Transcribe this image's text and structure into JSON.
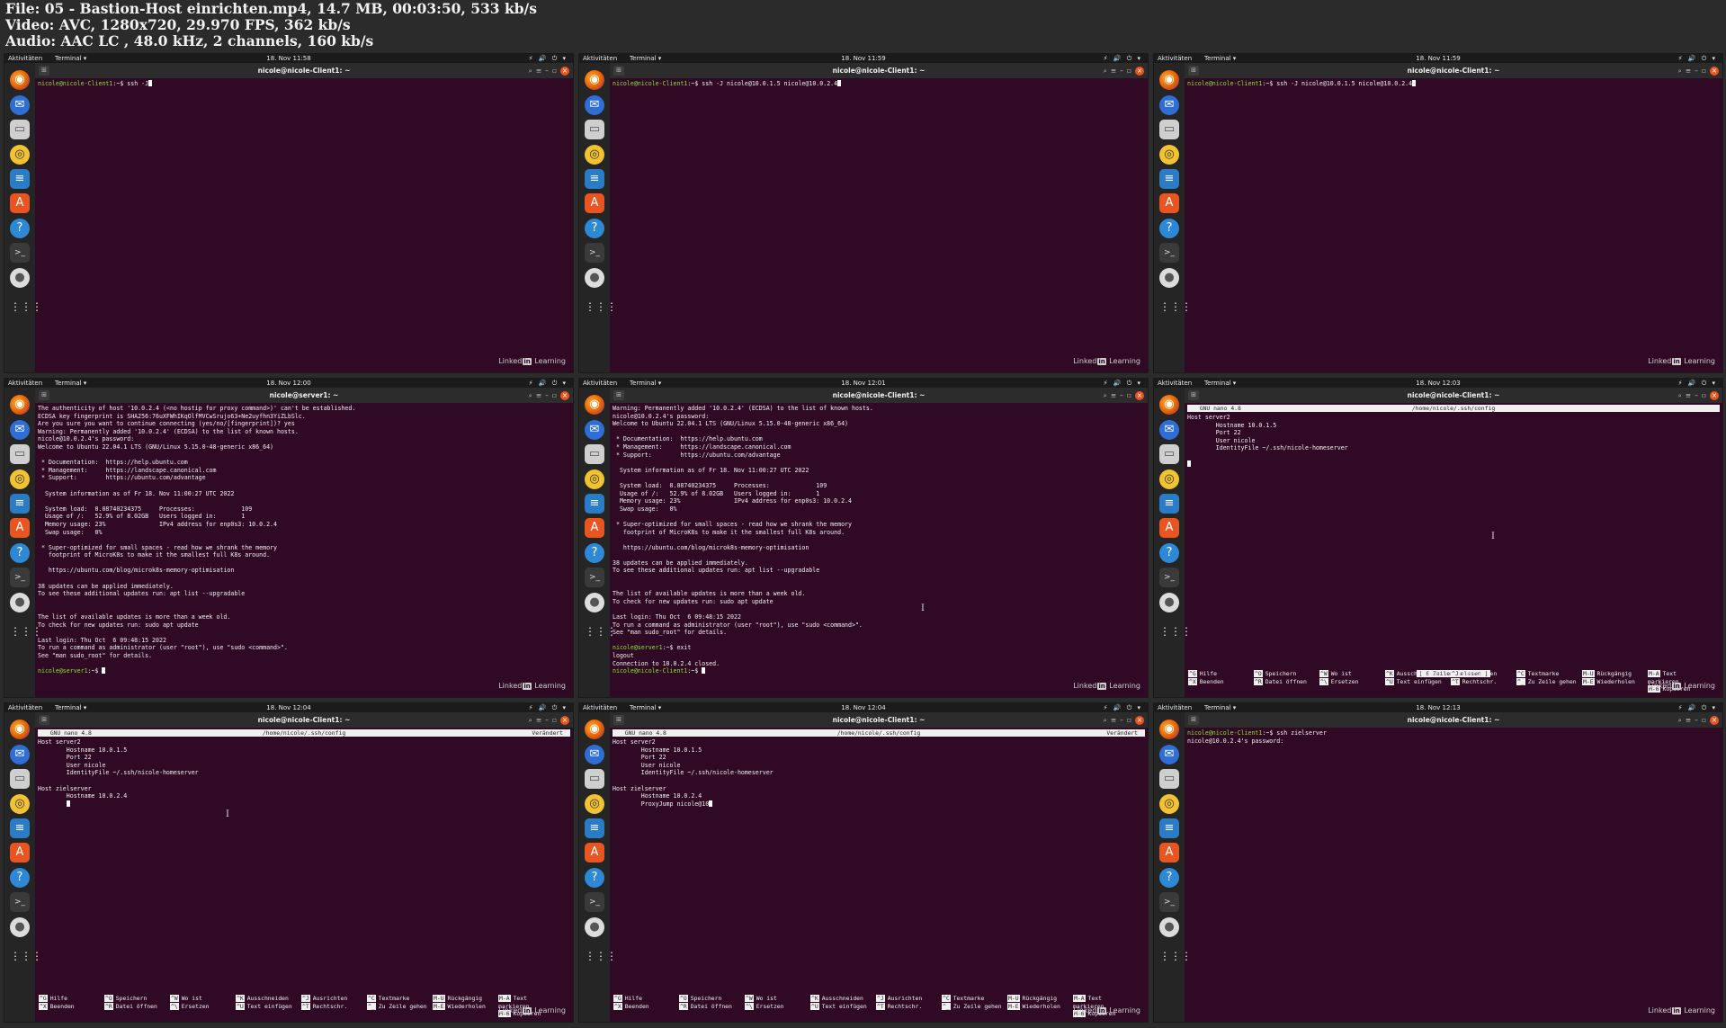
{
  "header": {
    "file_line": "File: 05 - Bastion-Host einrichten.mp4, 14.7 MB, 00:03:50, 533 kb/s",
    "video_line": "Video: AVC, 1280x720, 29.970 FPS, 362 kb/s",
    "audio_line": "Audio: AAC LC , 48.0 kHz, 2 channels, 160 kb/s"
  },
  "common": {
    "activities": "Aktivitäten",
    "app_menu": "Terminal ▾",
    "tray": "⚡ 🔊 ⏻ ▾",
    "watermark_pre": "Linked",
    "watermark_in": "in",
    "watermark_post": " Learning",
    "dock_icons": [
      "firefox-icon",
      "thunderbird-icon",
      "files-icon",
      "rhythmbox-icon",
      "writer-icon",
      "app-center-icon",
      "help-icon",
      "terminal-icon",
      "dvd-icon",
      "show-apps-icon"
    ],
    "nano_name": "  GNU nano 4.8",
    "nano_path": "/home/nicole/.ssh/config",
    "nano_shortcuts": [
      {
        "k1": "^G",
        "l1": "Hilfe",
        "k2": "^X",
        "l2": "Beenden"
      },
      {
        "k1": "^O",
        "l1": "Speichern",
        "k2": "^R",
        "l2": "Datei öffnen"
      },
      {
        "k1": "^W",
        "l1": "Wo ist",
        "k2": "^\\",
        "l2": "Ersetzen"
      },
      {
        "k1": "^K",
        "l1": "Ausschneiden",
        "k2": "^U",
        "l2": "Text einfügen"
      },
      {
        "k1": "^J",
        "l1": "Ausrichten",
        "k2": "^T",
        "l2": "Rechtschr."
      },
      {
        "k1": "^C",
        "l1": "Textmarke",
        "k2": "^_",
        "l2": "Zu Zeile gehen"
      },
      {
        "k1": "M-U",
        "l1": "Rückgängig",
        "k2": "M-E",
        "l2": "Wiederholen"
      },
      {
        "k1": "M-A",
        "l1": "Text markieren",
        "k2": "M-6",
        "l2": "Kopieren"
      }
    ]
  },
  "frames": [
    {
      "clock": "18. Nov 11:58",
      "title": "nicole@nicole-Client1: ~",
      "type": "term",
      "lines": [
        {
          "p": "nicole@nicole-Client1",
          "t": ":~$ ssh -J",
          "cur": true
        }
      ]
    },
    {
      "clock": "18. Nov 11:59",
      "title": "nicole@nicole-Client1: ~",
      "type": "term",
      "lines": [
        {
          "p": "nicole@nicole-Client1",
          "t": ":~$ ssh -J nicole@10.0.1.5 nicole@10.0.2.4",
          "cur": true
        }
      ]
    },
    {
      "clock": "18. Nov 11:59",
      "title": "nicole@nicole-Client1: ~",
      "type": "term",
      "lines": [
        {
          "p": "nicole@nicole-Client1",
          "t": ":~$ ssh -J nicole@10.0.1.5 nicole@10.0.2.4",
          "cur": true
        }
      ]
    },
    {
      "clock": "18. Nov 12:00",
      "title": "nicole@server1: ~",
      "type": "term",
      "lines": [
        {
          "t": "The authenticity of host '10.0.2.4 (<no hostip for proxy command>)' can't be established."
        },
        {
          "t": "ECDSA key fingerprint is SHA256:76uXFWhIKqOlfMVCwSrujo63+Ne2uyfhn3YiZLbSlc."
        },
        {
          "t": "Are you sure you want to continue connecting (yes/no/[fingerprint])? yes"
        },
        {
          "t": "Warning: Permanently added '10.0.2.4' (ECDSA) to the list of known hosts."
        },
        {
          "t": "nicole@10.0.2.4's password:"
        },
        {
          "t": "Welcome to Ubuntu 22.04.1 LTS (GNU/Linux 5.15.0-48-generic x86_64)"
        },
        {
          "t": ""
        },
        {
          "t": " * Documentation:  https://help.ubuntu.com"
        },
        {
          "t": " * Management:     https://landscape.canonical.com"
        },
        {
          "t": " * Support:        https://ubuntu.com/advantage"
        },
        {
          "t": ""
        },
        {
          "t": "  System information as of Fr 18. Nov 11:00:27 UTC 2022"
        },
        {
          "t": ""
        },
        {
          "t": "  System load:  0.08740234375     Processes:             109"
        },
        {
          "t": "  Usage of /:   52.9% of 8.02GB   Users logged in:       1"
        },
        {
          "t": "  Memory usage: 23%               IPv4 address for enp0s3: 10.0.2.4"
        },
        {
          "t": "  Swap usage:   0%"
        },
        {
          "t": ""
        },
        {
          "t": " * Super-optimized for small spaces - read how we shrank the memory"
        },
        {
          "t": "   footprint of MicroK8s to make it the smallest full K8s around."
        },
        {
          "t": ""
        },
        {
          "t": "   https://ubuntu.com/blog/microk8s-memory-optimisation"
        },
        {
          "t": ""
        },
        {
          "t": "38 updates can be applied immediately."
        },
        {
          "t": "To see these additional updates run: apt list --upgradable"
        },
        {
          "t": ""
        },
        {
          "t": ""
        },
        {
          "t": "The list of available updates is more than a week old."
        },
        {
          "t": "To check for new updates run: sudo apt update"
        },
        {
          "t": ""
        },
        {
          "t": "Last login: Thu Oct  6 09:48:15 2022"
        },
        {
          "t": "To run a command as administrator (user \"root\"), use \"sudo <command>\"."
        },
        {
          "t": "See \"man sudo_root\" for details."
        },
        {
          "t": ""
        },
        {
          "p": "nicole@server1",
          "t": ":~$ ",
          "cur": true
        }
      ]
    },
    {
      "clock": "18. Nov 12:01",
      "title": "nicole@nicole-Client1: ~",
      "type": "term",
      "lines": [
        {
          "t": "Warning: Permanently added '10.0.2.4' (ECDSA) to the list of known hosts."
        },
        {
          "t": "nicole@10.0.2.4's password:"
        },
        {
          "t": "Welcome to Ubuntu 22.04.1 LTS (GNU/Linux 5.15.0-48-generic x86_64)"
        },
        {
          "t": ""
        },
        {
          "t": " * Documentation:  https://help.ubuntu.com"
        },
        {
          "t": " * Management:     https://landscape.canonical.com"
        },
        {
          "t": " * Support:        https://ubuntu.com/advantage"
        },
        {
          "t": ""
        },
        {
          "t": "  System information as of Fr 18. Nov 11:00:27 UTC 2022"
        },
        {
          "t": ""
        },
        {
          "t": "  System load:  0.08740234375     Processes:             109"
        },
        {
          "t": "  Usage of /:   52.9% of 8.02GB   Users logged in:       1"
        },
        {
          "t": "  Memory usage: 23%               IPv4 address for enp0s3: 10.0.2.4"
        },
        {
          "t": "  Swap usage:   0%"
        },
        {
          "t": ""
        },
        {
          "t": " * Super-optimized for small spaces - read how we shrank the memory"
        },
        {
          "t": "   footprint of MicroK8s to make it the smallest full K8s around."
        },
        {
          "t": ""
        },
        {
          "t": "   https://ubuntu.com/blog/microk8s-memory-optimisation"
        },
        {
          "t": ""
        },
        {
          "t": "38 updates can be applied immediately."
        },
        {
          "t": "To see these additional updates run: apt list --upgradable"
        },
        {
          "t": ""
        },
        {
          "t": ""
        },
        {
          "t": "The list of available updates is more than a week old."
        },
        {
          "t": "To check for new updates run: sudo apt update"
        },
        {
          "t": ""
        },
        {
          "t": "Last login: Thu Oct  6 09:48:15 2022"
        },
        {
          "t": "To run a command as administrator (user \"root\"), use \"sudo <command>\"."
        },
        {
          "t": "See \"man sudo_root\" for details."
        },
        {
          "t": ""
        },
        {
          "p": "nicole@server1",
          "t": ":~$ exit"
        },
        {
          "t": "logout"
        },
        {
          "t": "Connection to 10.0.2.4 closed."
        },
        {
          "p": "nicole@nicole-Client1",
          "t": ":~$ ",
          "cur": true
        }
      ]
    },
    {
      "clock": "18. Nov 12:03",
      "title": "nicole@nicole-Client1: ~",
      "type": "nano",
      "modified": "",
      "status": "[ 6 Zeilen gelesen ]",
      "lines": [
        {
          "t": "Host server2"
        },
        {
          "t": "        Hostname 10.0.1.5"
        },
        {
          "t": "        Port 22"
        },
        {
          "t": "        User nicole"
        },
        {
          "t": "        IdentityFile ~/.ssh/nicole-homeserver"
        },
        {
          "t": ""
        },
        {
          "t": "",
          "cur": true
        }
      ]
    },
    {
      "clock": "18. Nov 12:04",
      "title": "nicole@nicole-Client1: ~",
      "type": "nano",
      "modified": "Verändert",
      "status": "",
      "lines": [
        {
          "t": "Host server2"
        },
        {
          "t": "        Hostname 10.0.1.5"
        },
        {
          "t": "        Port 22"
        },
        {
          "t": "        User nicole"
        },
        {
          "t": "        IdentityFile ~/.ssh/nicole-homeserver"
        },
        {
          "t": ""
        },
        {
          "t": "Host zielserver"
        },
        {
          "t": "        Hostname 10.0.2.4"
        },
        {
          "t": "        ",
          "cur": true
        }
      ]
    },
    {
      "clock": "18. Nov 12:04",
      "title": "nicole@nicole-Client1: ~",
      "type": "nano",
      "modified": "Verändert",
      "status": "",
      "lines": [
        {
          "t": "Host server2"
        },
        {
          "t": "        Hostname 10.0.1.5"
        },
        {
          "t": "        Port 22"
        },
        {
          "t": "        User nicole"
        },
        {
          "t": "        IdentityFile ~/.ssh/nicole-homeserver"
        },
        {
          "t": ""
        },
        {
          "t": "Host zielserver"
        },
        {
          "t": "        Hostname 10.0.2.4"
        },
        {
          "t": "        ProxyJump nicole@10",
          "cur": true
        }
      ]
    },
    {
      "clock": "18. Nov 12:13",
      "title": "nicole@nicole-Client1: ~",
      "type": "term",
      "lines": [
        {
          "p": "nicole@nicole-Client1",
          "t": ":~$ ssh zielserver"
        },
        {
          "t": "nicole@10.0.2.4's password:"
        }
      ]
    }
  ]
}
